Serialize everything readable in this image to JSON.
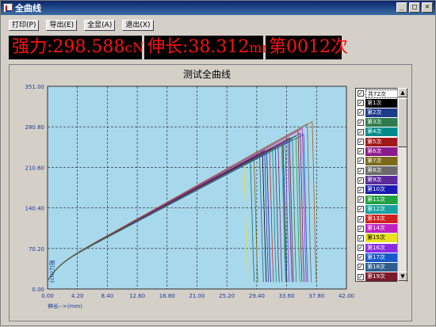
{
  "window": {
    "title": "全曲线"
  },
  "window_buttons": [
    "_",
    "□",
    "×"
  ],
  "toolbar": {
    "buttons": [
      "打印(P)",
      "导出(E)",
      "全显(A)",
      "退出(X)"
    ]
  },
  "readout": {
    "force_label": "强力:",
    "force_value": "298.588",
    "force_unit": "cN",
    "elong_label": "伸长:",
    "elong_value": "38.312",
    "elong_unit": "mm",
    "count_prefix": "第",
    "count_value": "0012",
    "count_suffix": "次"
  },
  "chart": {
    "title": "测试全曲线",
    "xlabel": "伸长-->(mm)",
    "ylabel": "(cN)力强"
  },
  "legend": {
    "items": [
      {
        "label": "共72次",
        "color": "#ffffff"
      },
      {
        "label": "第1次",
        "color": "#000000"
      },
      {
        "label": "第2次",
        "color": "#1e3a8a"
      },
      {
        "label": "第3次",
        "color": "#2f7a4a"
      },
      {
        "label": "第4次",
        "color": "#008b8b"
      },
      {
        "label": "第5次",
        "color": "#a01818"
      },
      {
        "label": "第6次",
        "color": "#8b1a8b"
      },
      {
        "label": "第7次",
        "color": "#7a6a1a"
      },
      {
        "label": "第8次",
        "color": "#6a6a6a"
      },
      {
        "label": "第9次",
        "color": "#5a2a9a"
      },
      {
        "label": "第10次",
        "color": "#1a1ab0"
      },
      {
        "label": "第11次",
        "color": "#20a040"
      },
      {
        "label": "第12次",
        "color": "#18a0a0"
      },
      {
        "label": "第13次",
        "color": "#d02020"
      },
      {
        "label": "第14次",
        "color": "#c020c0"
      },
      {
        "label": "第15次",
        "color": "#e8e020"
      },
      {
        "label": "第16次",
        "color": "#8a2be2"
      },
      {
        "label": "第17次",
        "color": "#1858c8"
      },
      {
        "label": "第18次",
        "color": "#2e5e8e"
      },
      {
        "label": "第19次",
        "color": "#7a1a2a"
      }
    ]
  },
  "chart_data": {
    "type": "line",
    "title": "测试全曲线",
    "xlabel": "伸长-->(mm)",
    "ylabel": "(cN)力强",
    "xlim": [
      0,
      42
    ],
    "ylim": [
      0,
      351
    ],
    "xticks": [
      "0.00",
      "4.20",
      "8.40",
      "12.60",
      "16.80",
      "21.00",
      "25.20",
      "29.40",
      "33.60",
      "37.80",
      "42.00"
    ],
    "yticks": [
      "0.00",
      "70.20",
      "140.40",
      "210.60",
      "280.80",
      "351.00"
    ],
    "grid": true,
    "legend_position": "right",
    "background": "#a8d8ec",
    "series": [
      {
        "color": "#000000",
        "break_x": 30.2,
        "peak_y": 238
      },
      {
        "color": "#1e3a8a",
        "break_x": 33.1,
        "peak_y": 252
      },
      {
        "color": "#2f7a4a",
        "break_x": 34.4,
        "peak_y": 260
      },
      {
        "color": "#008b8b",
        "break_x": 31.6,
        "peak_y": 244
      },
      {
        "color": "#a01818",
        "break_x": 35.2,
        "peak_y": 274
      },
      {
        "color": "#8b1a8b",
        "break_x": 32.4,
        "peak_y": 249
      },
      {
        "color": "#7a6a1a",
        "break_x": 29.0,
        "peak_y": 228
      },
      {
        "color": "#6a6a6a",
        "break_x": 36.5,
        "peak_y": 286
      },
      {
        "color": "#5a2a9a",
        "break_x": 33.8,
        "peak_y": 256
      },
      {
        "color": "#1a1ab0",
        "break_x": 30.8,
        "peak_y": 236
      },
      {
        "color": "#20a040",
        "break_x": 34.9,
        "peak_y": 265
      },
      {
        "color": "#18a0a0",
        "break_x": 32.9,
        "peak_y": 250
      },
      {
        "color": "#d02020",
        "break_x": 31.2,
        "peak_y": 242
      },
      {
        "color": "#c020c0",
        "break_x": 35.8,
        "peak_y": 278
      },
      {
        "color": "#e8e020",
        "break_x": 27.6,
        "peak_y": 216
      },
      {
        "color": "#8a2be2",
        "break_x": 33.4,
        "peak_y": 255
      },
      {
        "color": "#1858c8",
        "break_x": 36.0,
        "peak_y": 268
      },
      {
        "color": "#2e5e8e",
        "break_x": 29.8,
        "peak_y": 233
      },
      {
        "color": "#7a1a2a",
        "break_x": 34.0,
        "peak_y": 262
      },
      {
        "color": "#404040",
        "break_x": 32.0,
        "peak_y": 246
      },
      {
        "color": "#b05a10",
        "break_x": 37.2,
        "peak_y": 290
      },
      {
        "color": "#106a6a",
        "break_x": 28.5,
        "peak_y": 222
      },
      {
        "color": "#6a1a6a",
        "break_x": 35.5,
        "peak_y": 270
      },
      {
        "color": "#3a3a9a",
        "break_x": 30.5,
        "peak_y": 240
      },
      {
        "color": "#5a7a1a",
        "break_x": 33.0,
        "peak_y": 251
      }
    ]
  }
}
